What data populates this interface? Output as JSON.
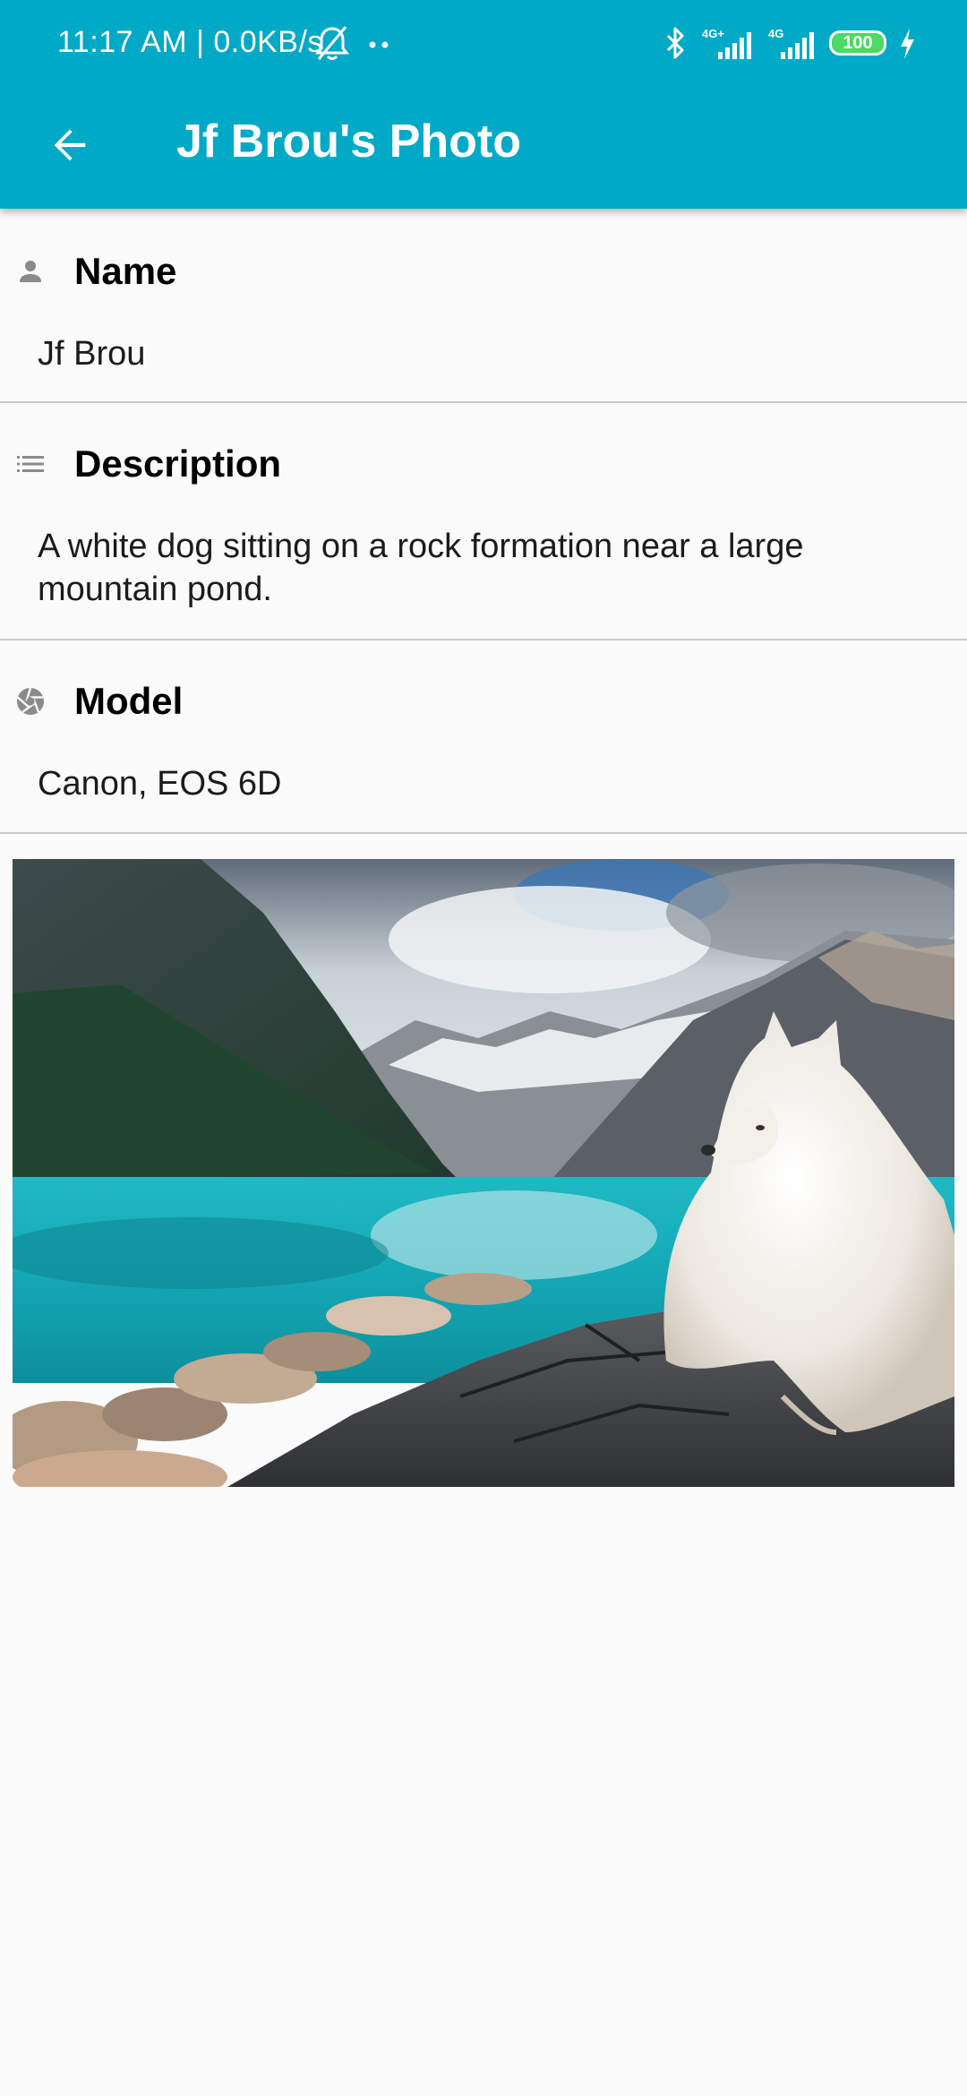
{
  "status_bar": {
    "time": "11:17 AM | 0.0KB/s",
    "battery": "100",
    "net_label_1": "4G+",
    "net_label_2": "4G"
  },
  "toolbar": {
    "title": "Jf Brou's Photo",
    "back_icon": "arrow-back-icon"
  },
  "sections": [
    {
      "icon": "person-icon",
      "heading": "Name",
      "value": "Jf Brou"
    },
    {
      "icon": "list-icon",
      "heading": "Description",
      "value": "A white dog sitting on a rock formation near a large mountain pond."
    },
    {
      "icon": "camera-aperture-icon",
      "heading": "Model",
      "value": "Canon, EOS 6D"
    }
  ],
  "colors": {
    "app_bar": "#00a9c6",
    "background": "#fafafa",
    "divider": "#c9c9c9",
    "icon_grey": "#8a8a8a"
  }
}
